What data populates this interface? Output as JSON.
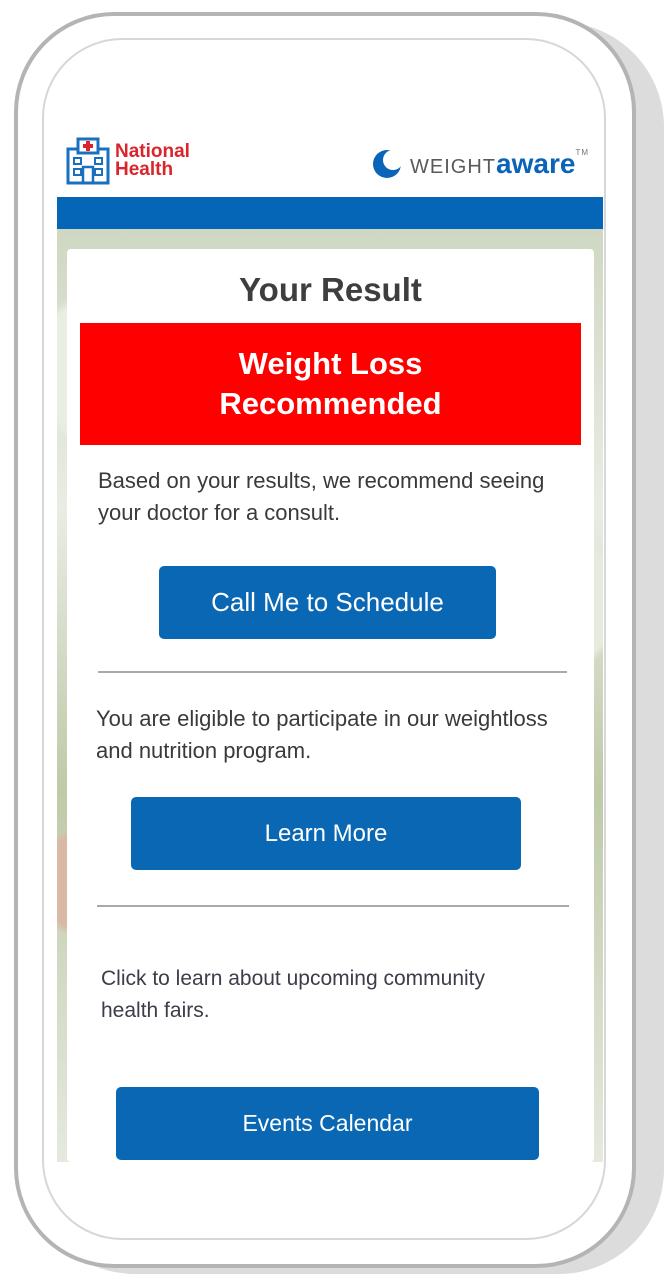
{
  "header": {
    "national_health_line1": "National",
    "national_health_line2": "Health",
    "weightaware_light": "WEIGHT",
    "weightaware_bold": "aware",
    "weightaware_tm": "TM",
    "brand_red": "#d9252b",
    "brand_blue": "#0566b7"
  },
  "result": {
    "title": "Your Result",
    "status": "Weight Loss Recommended",
    "status_color": "#ff0000"
  },
  "sections": {
    "doctor_text": "Based on your results, we recommend seeing your doctor for a consult.",
    "doctor_button": "Call Me to Schedule",
    "program_text": "You are eligible to participate in our weightloss and nutrition program.",
    "program_button": "Learn More",
    "events_text": "Click to learn about upcoming community health fairs.",
    "events_button": "Events Calendar"
  },
  "icons": {
    "hospital": "hospital-icon",
    "weightaware": "weightaware-logo-icon"
  }
}
